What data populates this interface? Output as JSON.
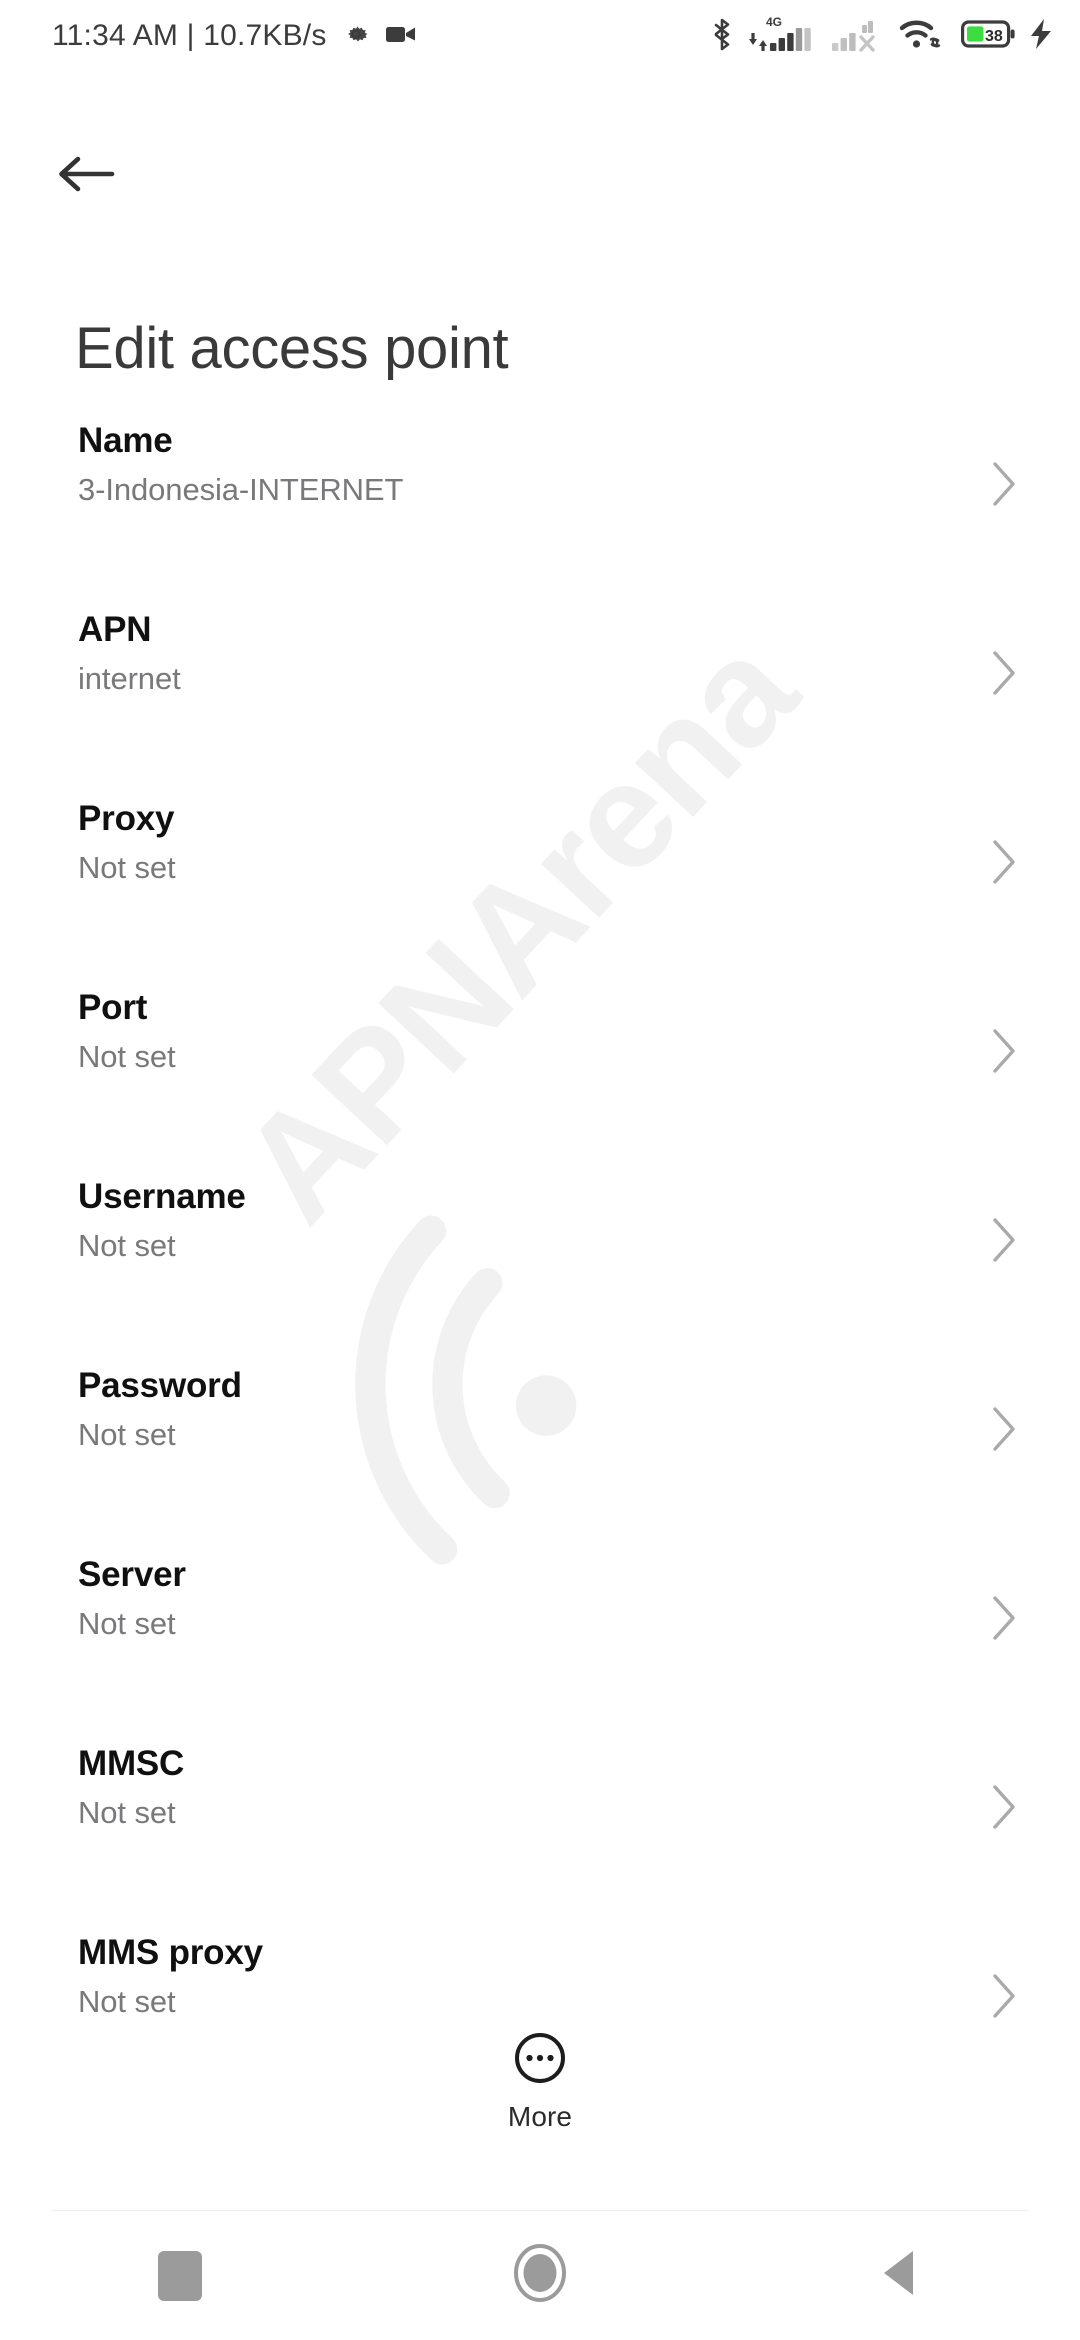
{
  "status_bar": {
    "clock": "11:34 AM | 10.7KB/s",
    "left_icons": [
      "gear-icon",
      "video-camera-icon"
    ],
    "right_icons": [
      "bluetooth-icon",
      "mobile-signal-4g-icon",
      "mobile-signal-no-service-icon",
      "wifi-link-icon",
      "battery-icon",
      "charging-bolt-icon"
    ],
    "network_type": "4G",
    "battery_percent": "38",
    "battery_color": "#3ddc41",
    "charging": true
  },
  "app_bar": {
    "back_icon": "arrow-left-icon",
    "title": "Edit access point"
  },
  "watermark": {
    "text": "APNArena",
    "color": "#f1f1f1"
  },
  "settings_list": {
    "chevron_icon": "chevron-right-icon",
    "items": [
      {
        "title": "Name",
        "value": "3-Indonesia-INTERNET"
      },
      {
        "title": "APN",
        "value": "internet"
      },
      {
        "title": "Proxy",
        "value": "Not set"
      },
      {
        "title": "Port",
        "value": "Not set"
      },
      {
        "title": "Username",
        "value": "Not set"
      },
      {
        "title": "Password",
        "value": "Not set"
      },
      {
        "title": "Server",
        "value": "Not set"
      },
      {
        "title": "MMSC",
        "value": "Not set"
      },
      {
        "title": "MMS proxy",
        "value": "Not set"
      }
    ]
  },
  "more_button": {
    "label": "More",
    "icon": "more-horizontal-circle-icon"
  },
  "nav_bar": {
    "recents_label": "recents-square-icon",
    "home_label": "home-circle-icon",
    "back_label": "back-triangle-icon",
    "color": "#9b9b9b"
  }
}
